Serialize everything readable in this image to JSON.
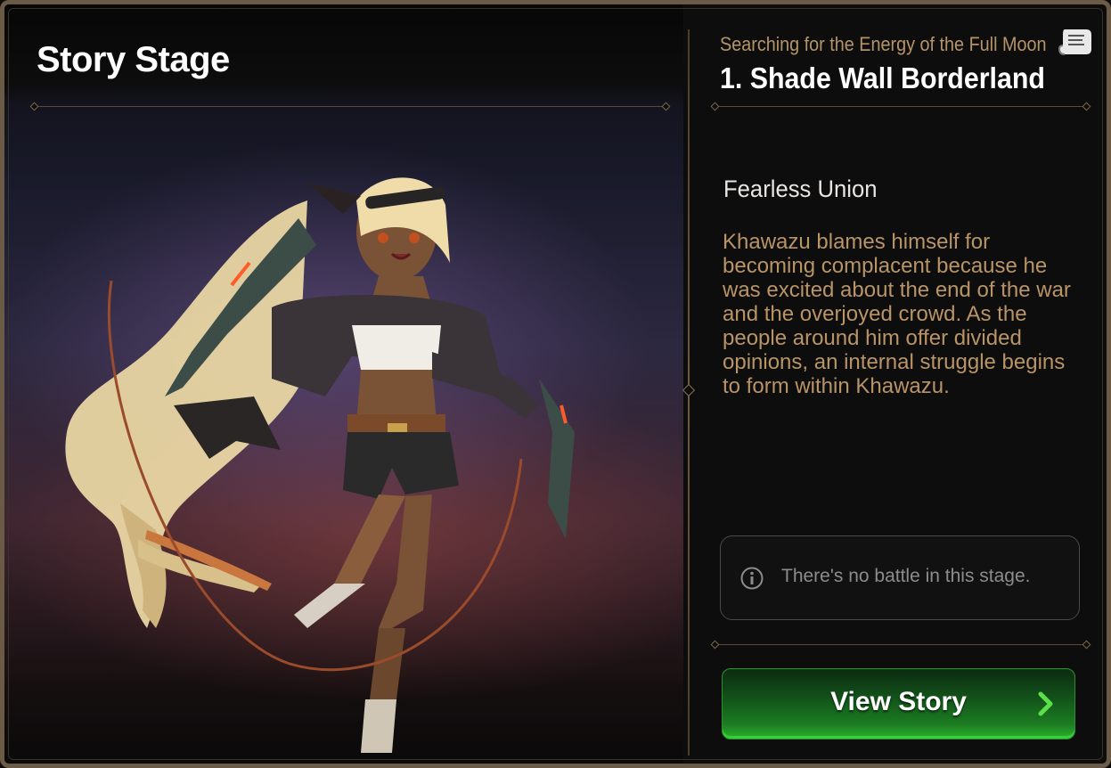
{
  "page": {
    "title": "Story Stage"
  },
  "stage": {
    "chapter_subtitle": "Searching for the Energy of the Full Moon",
    "title": "1. Shade Wall Borderland",
    "name": "Fearless Union",
    "description": "Khawazu blames himself for becoming complacent because he was excited about the end of the war and the overjoyed crowd. As the people around him offer divided opinions, an internal struggle begins to form within Khawazu."
  },
  "notice": {
    "icon": "info-icon",
    "text": "There's no battle in this stage."
  },
  "actions": {
    "view_story_label": "View Story",
    "view_story_icon": "chevron-right-icon",
    "scroll_icon": "scroll-icon"
  },
  "colors": {
    "frame_border": "#6b5a45",
    "subtitle_gold": "#b49467",
    "description_gold": "#b89466",
    "button_green": "#2bb52d",
    "chevron_green": "#5be04a"
  }
}
